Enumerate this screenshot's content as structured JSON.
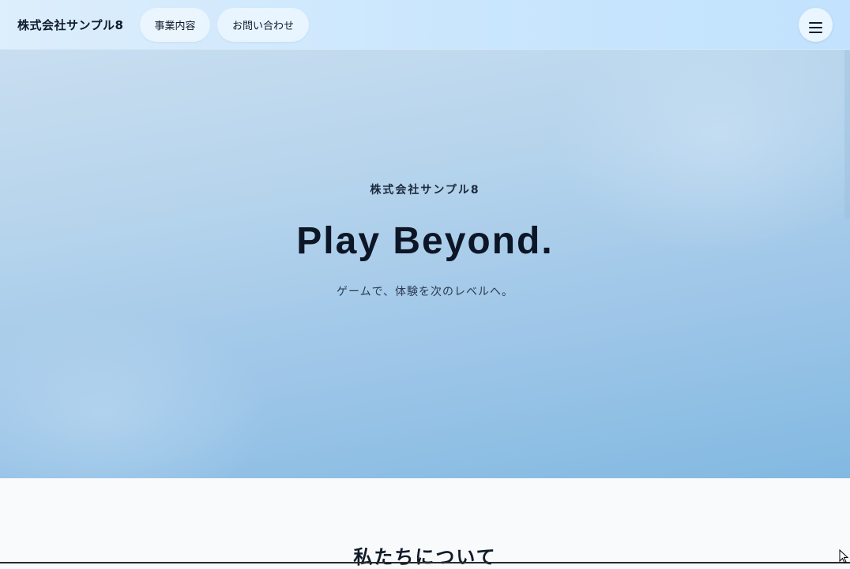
{
  "header": {
    "logo": "株式会社サンプル8",
    "nav": [
      {
        "label": "事業内容"
      },
      {
        "label": "お問い合わせ"
      }
    ],
    "menu_icon": "hamburger-menu-icon"
  },
  "hero": {
    "kicker": "株式会社サンプル8",
    "title": "Play Beyond.",
    "subtitle": "ゲームで、体験を次のレベルへ。"
  },
  "about": {
    "title": "私たちについて"
  },
  "colors": {
    "header_bg": "#c9e6fd",
    "hero_top": "#c9def0",
    "hero_bottom": "#82b9e1",
    "text": "#0f1b2d",
    "section_bg": "#f8fafc"
  }
}
